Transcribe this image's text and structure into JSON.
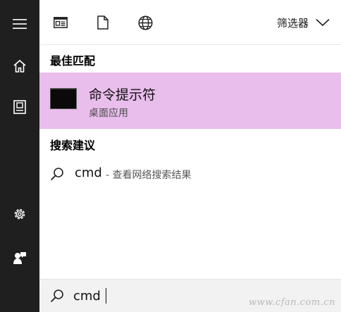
{
  "rail": {
    "items": [
      {
        "icon": "hamburger-menu-icon"
      },
      {
        "icon": "home-icon"
      },
      {
        "icon": "notebook-icon"
      },
      {
        "icon": "settings-gear-icon"
      },
      {
        "icon": "feedback-icon"
      }
    ]
  },
  "toolbar": {
    "filters": [
      {
        "icon": "apps-window-icon"
      },
      {
        "icon": "documents-icon"
      },
      {
        "icon": "web-globe-icon"
      }
    ],
    "filter_label": "筛选器"
  },
  "best_match": {
    "heading": "最佳匹配",
    "title": "命令提示符",
    "subtitle": "桌面应用",
    "highlight_color": "#e9bdec"
  },
  "suggestions": {
    "heading": "搜索建议",
    "items": [
      {
        "term": "cmd",
        "hint": "- 查看网络搜索结果"
      }
    ]
  },
  "search": {
    "value": "cmd"
  },
  "watermark": "www.cfan.com.cn"
}
